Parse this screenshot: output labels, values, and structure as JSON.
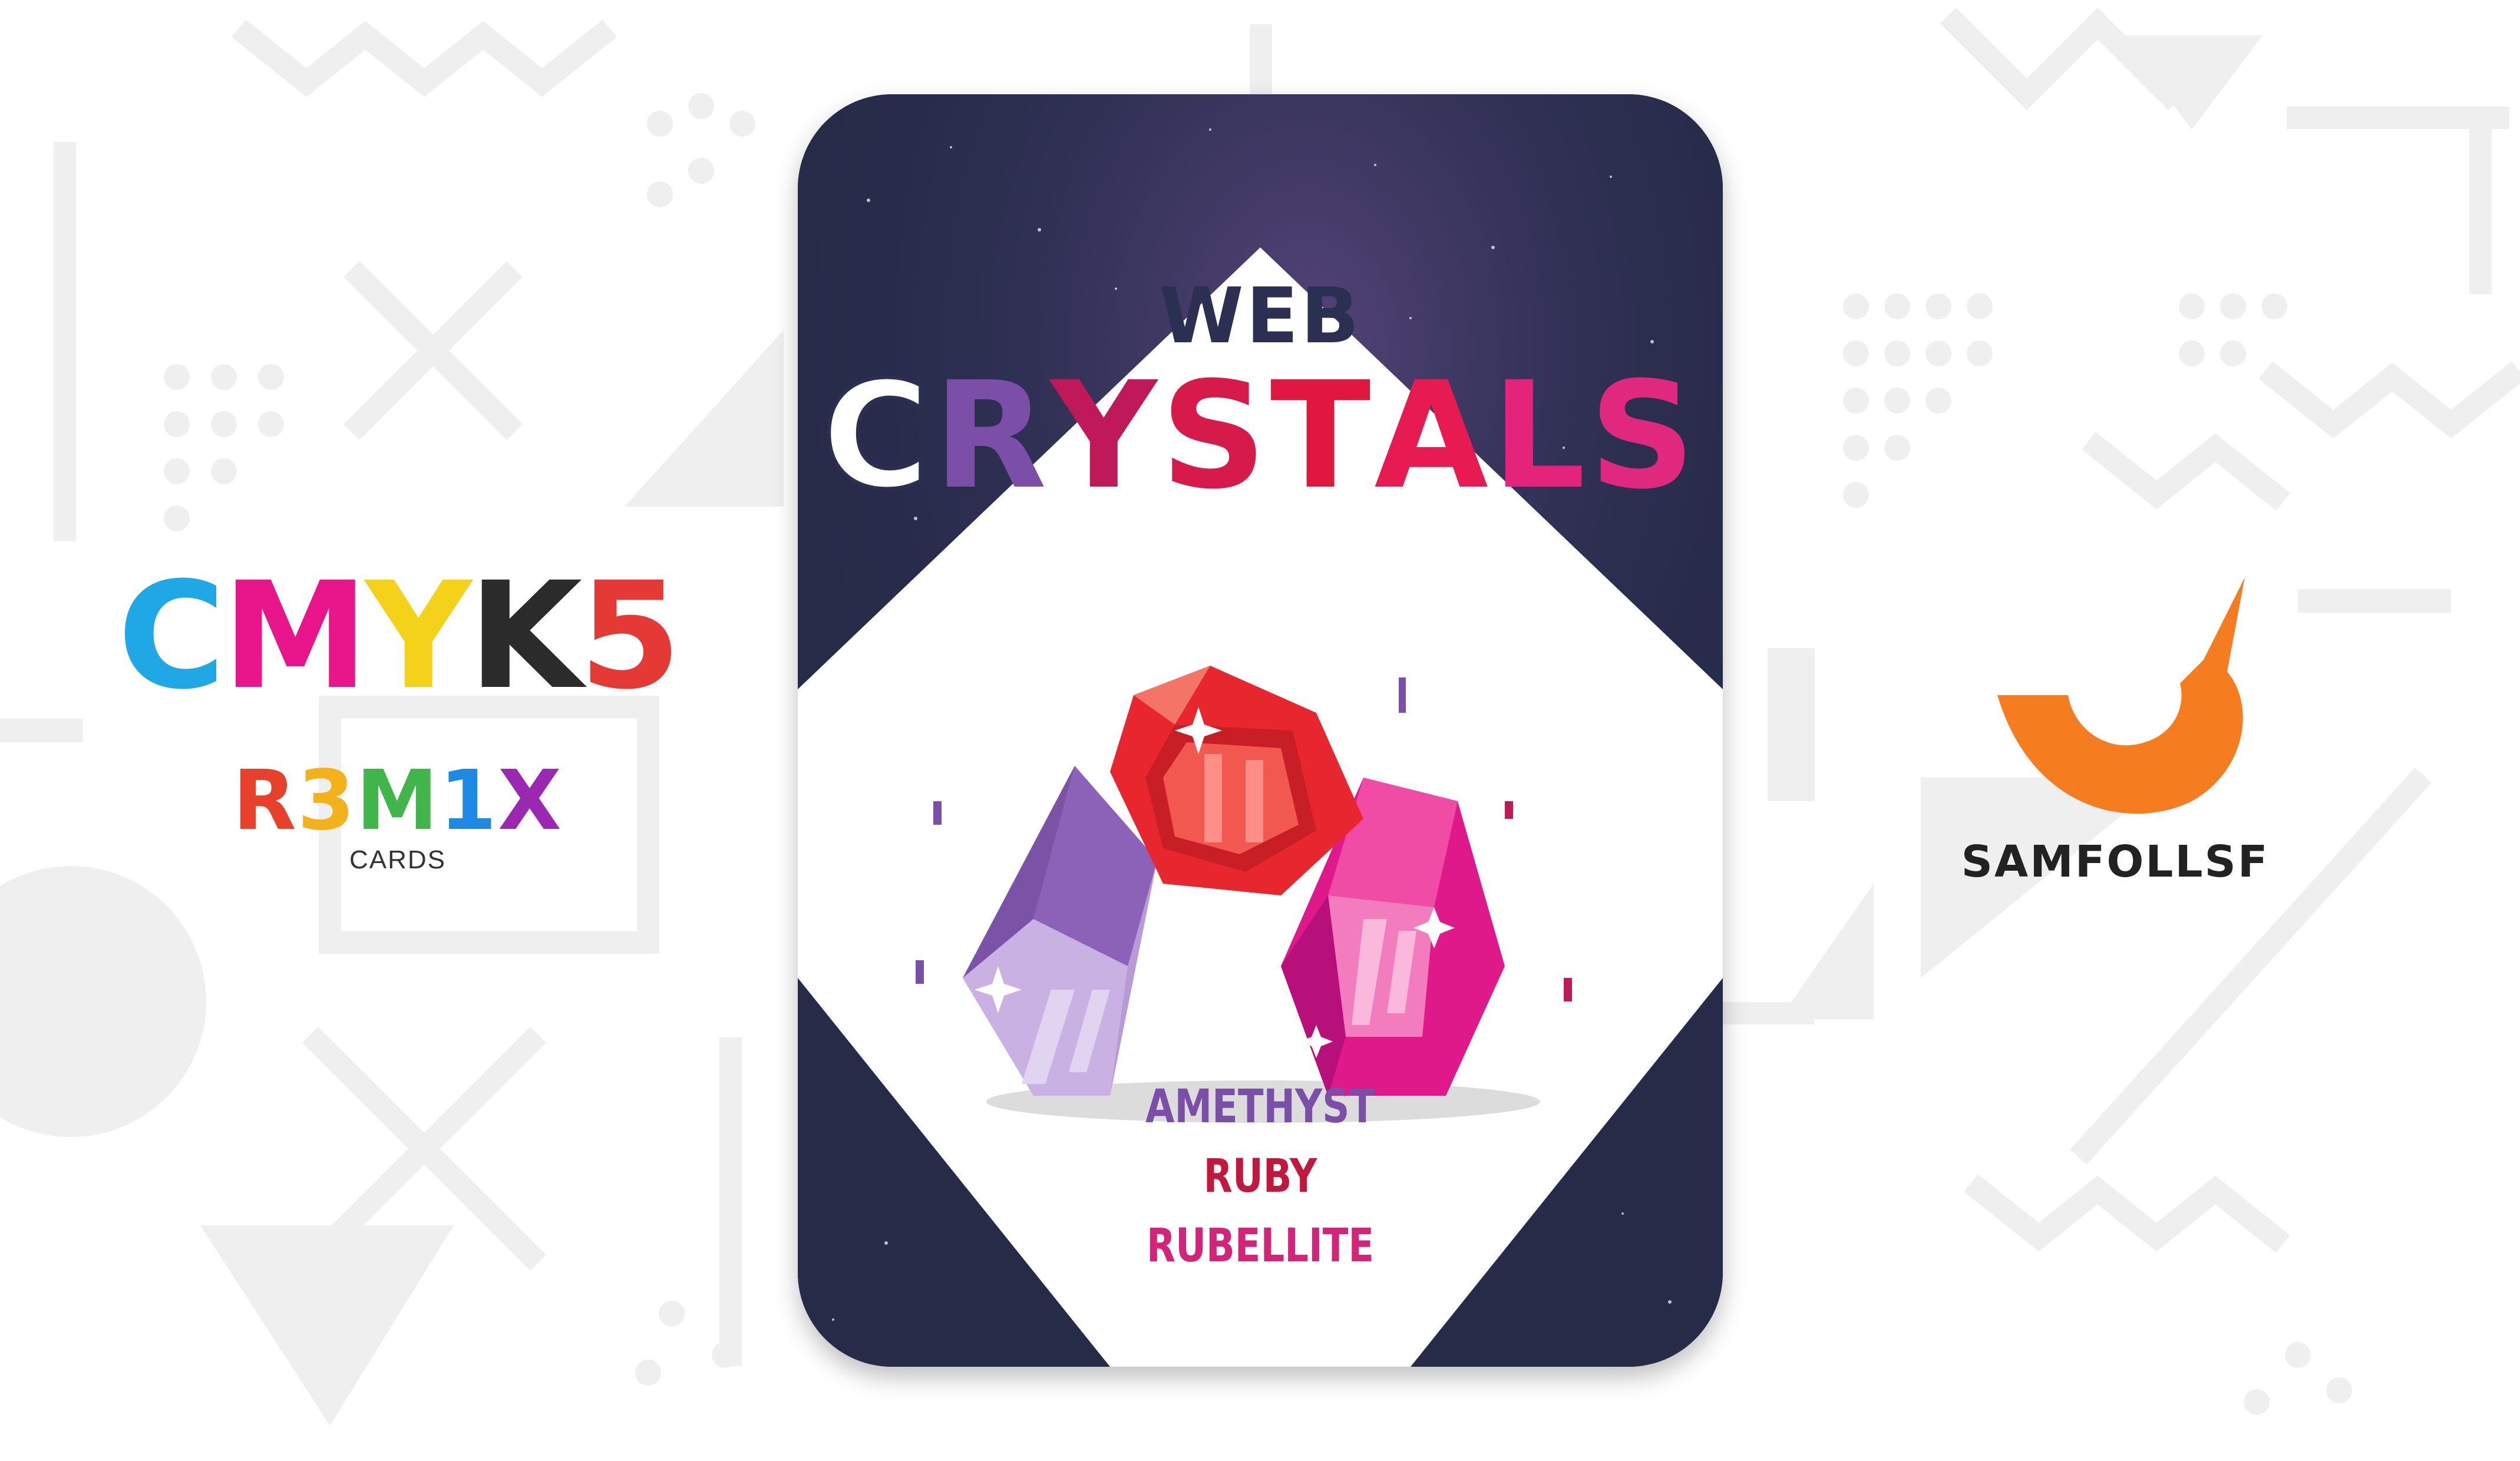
{
  "left_brand": {
    "logo_letters": [
      "C",
      "M",
      "Y",
      "K",
      "5"
    ],
    "logo_colors": [
      "#1fa7e6",
      "#e8168a",
      "#f4d21a",
      "#2b2b2b",
      "#e53935"
    ],
    "remix_letters": [
      "R",
      "3",
      "M",
      "1",
      "X"
    ],
    "remix_colors": [
      "#e8412b",
      "#f4b21a",
      "#3fb54a",
      "#1e88e5",
      "#9c27b0"
    ],
    "cards_label": "CARDS"
  },
  "card": {
    "title_top": "WEB",
    "title_main_letters": [
      "C",
      "R",
      "Y",
      "S",
      "T",
      "A",
      "L",
      "S"
    ],
    "title_main_colors": [
      "#ffffff",
      "#7b4fa8",
      "#c0195a",
      "#d61a4a",
      "#e0183f",
      "#e81a52",
      "#e4247a",
      "#e0287f"
    ],
    "gem_names": [
      "AMETHYST",
      "RUBY",
      "RUBELLITE"
    ],
    "gem_name_colors": [
      "#7b4fa8",
      "#c2183d",
      "#d4247a"
    ],
    "sky_color": "#262b48",
    "diamond_color": "#ffffff"
  },
  "right_brand": {
    "name": "SAMFOLLSF",
    "logo_color": "#f57c1f"
  }
}
